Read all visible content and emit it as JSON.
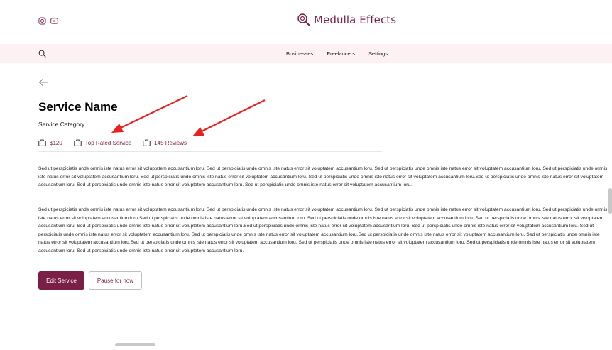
{
  "header": {
    "brand_name": "Medulla Effects",
    "social": [
      "instagram-icon",
      "youtube-icon"
    ]
  },
  "nav": {
    "links": [
      "Businesses",
      "Freelancers",
      "Settings"
    ]
  },
  "service": {
    "title": "Service Name",
    "category": "Service Category",
    "price": "$120",
    "badge": "Top Rated Service",
    "reviews": "145 Reviews"
  },
  "description": {
    "paragraph_1": "Sed ut perspiciatis unde omnis iste natus error sit voluptatem accusantium loru. Sed ut perspiciatis unde omnis iste natus error sit voluptatem accusantium loru. Sed ut perspiciatis unde omnis iste natus error sit voluptatem accusantium loru. Sed ut perspiciatis unde omnis iste natus error sit voluptatem accusantium loru. Sed ut perspiciatis unde omnis iste natus error sit voluptatem accusantium loru. Sed ut perspiciatis unde omnis iste natus error sit voluptatem accusantium loru.Sed ut perspiciatis unde omnis iste natus error sit voluptatem accusantium loru. Sed ut perspiciatis unde omnis iste natus error sit voluptatem accusantium loru. Sed ut perspiciatis unde omnis iste natus error sit voluptatem accusantium loru.",
    "paragraph_2": "Sed ut perspiciatis unde omnis iste natus error sit voluptatem accusantium loru. Sed ut perspiciatis unde omnis iste natus error sit voluptatem accusantium loru. Sed ut perspiciatis unde omnis iste natus error sit voluptatem accusantium loru. Sed ut perspiciatis unde omnis iste natus error sit voluptatem accusantium loru.Sed ut perspiciatis unde omnis iste natus error sit voluptatem accusantium loru. Sed ut perspiciatis unde omnis iste natus error sit voluptatem accusantium loru. Sed ut perspiciatis unde omnis iste natus error sit voluptatem accusantium loru. Sed ut perspiciatis unde omnis iste natus error sit voluptatem accusantium loru.Sed ut perspiciatis unde omnis iste natus error sit voluptatem accusantium loru. Sed ut perspiciatis unde omnis iste natus error sit voluptatem accusantium loru. Sed ut perspiciatis unde omnis iste natus error sit voluptatem accusantium loru. Sed ut perspiciatis unde omnis iste natus error sit voluptatem accusantium loru.Sed ut perspiciatis unde omnis iste natus error sit voluptatem accusantium loru. Sed ut perspiciatis unde omnis iste natus error sit voluptatem accusantium loru.Sed ut perspiciatis unde omnis iste natus error sit voluptatem accusantium loru. Sed ut perspiciatis unde omnis iste natus error sit voluptatem accusantium loru. Sed ut perspiciatis unde omnis iste natus error sit voluptatem accusantium loru. Sed ut perspiciatis unde omnis iste natus error sit voluptatem accusantium loru."
  },
  "actions": {
    "edit_label": "Edit Service",
    "pause_label": "Pause for now"
  },
  "colors": {
    "brand": "#7a1f45",
    "nav_background": "#fdf1f4",
    "annotation_arrow": "#e8201f"
  }
}
